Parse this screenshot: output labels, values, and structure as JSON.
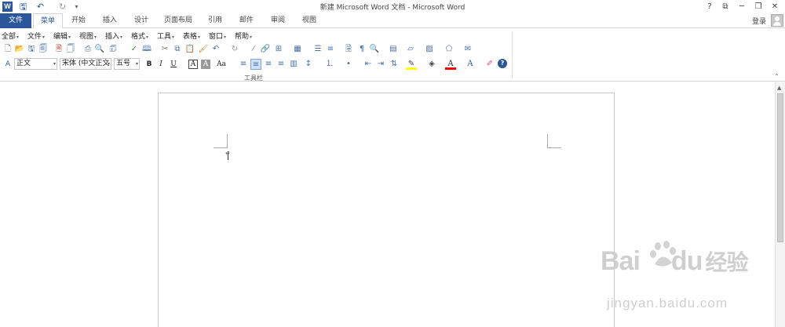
{
  "titlebar": {
    "app_icon_letter": "W",
    "title": "新建 Microsoft Word 文档 - Microsoft Word",
    "qat": [
      {
        "icon": "save-icon",
        "glyph": "🖫"
      },
      {
        "icon": "undo-icon",
        "glyph": "↶"
      },
      {
        "icon": "redo-icon",
        "glyph": "↻"
      },
      {
        "icon": "customize-qat-icon",
        "glyph": "▾"
      }
    ],
    "window_buttons": {
      "help": "?",
      "ribbon_options": "⧉",
      "minimize": "─",
      "restore": "❐",
      "close": "✕"
    }
  },
  "tabs": {
    "items": [
      {
        "label": "文件",
        "type": "file"
      },
      {
        "label": "菜单",
        "type": "active"
      },
      {
        "label": "开始"
      },
      {
        "label": "插入"
      },
      {
        "label": "设计"
      },
      {
        "label": "页面布局"
      },
      {
        "label": "引用"
      },
      {
        "label": "邮件"
      },
      {
        "label": "审阅"
      },
      {
        "label": "视图"
      }
    ],
    "login": "登录"
  },
  "ribbon": {
    "menu_items": [
      "全部",
      "文件",
      "编辑",
      "视图",
      "插入",
      "格式",
      "工具",
      "表格",
      "窗口",
      "帮助"
    ],
    "style_combo": "正文",
    "font_combo": "宋体 (中文正文",
    "size_combo": "五号",
    "format_buttons": {
      "bold": "B",
      "italic": "I",
      "underline": "U",
      "border": "A",
      "shading": "A",
      "change_case": "Aa"
    },
    "group_caption": "工具栏",
    "colors": {
      "highlight": "#ffff00",
      "font_color": "#ff0000",
      "accent": "#2b579a"
    }
  },
  "watermark": {
    "brand_latin_1": "Bai",
    "brand_latin_2": "du",
    "brand_cn": "经验",
    "url": "jingyan.baidu.com"
  }
}
